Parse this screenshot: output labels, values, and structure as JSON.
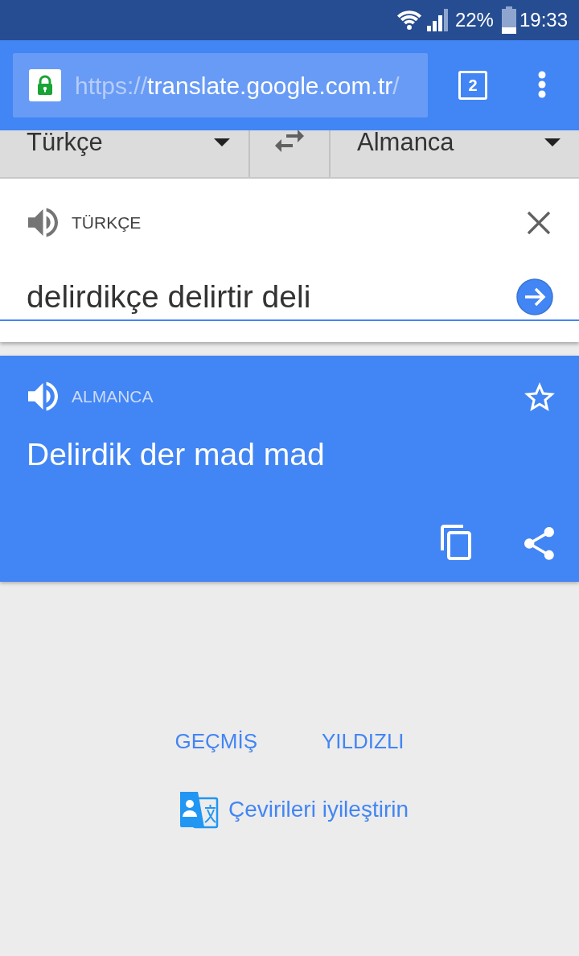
{
  "status_bar": {
    "battery": "22%",
    "time": "19:33"
  },
  "browser_toolbar": {
    "url": {
      "scheme": "https://",
      "host": "translate.google.com.tr",
      "path": "/"
    },
    "tab_count": "2"
  },
  "language_bar": {
    "source": "Türkçe",
    "target": "Almanca"
  },
  "input_card": {
    "language": "TÜRKÇE",
    "text": "delirdikçe delirtir deli"
  },
  "result_card": {
    "language": "ALMANCA",
    "text": "Delirdik der mad mad",
    "starred": false
  },
  "links": [
    {
      "label": "GEÇMİŞ"
    },
    {
      "label": "YILDIZLI"
    }
  ],
  "feedback": {
    "label": "Çevirileri iyileştirin"
  }
}
